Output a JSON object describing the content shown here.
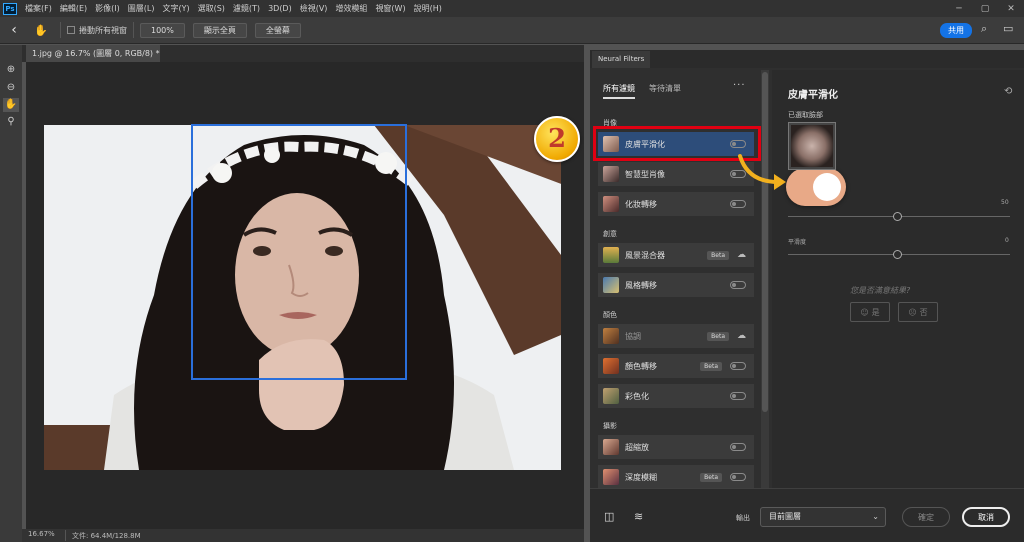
{
  "menubar": {
    "logo": "Ps",
    "items": [
      "檔案(F)",
      "編輯(E)",
      "影像(I)",
      "圖層(L)",
      "文字(Y)",
      "選取(S)",
      "濾鏡(T)",
      "3D(D)",
      "檢視(V)",
      "增效模組",
      "視窗(W)",
      "說明(H)"
    ]
  },
  "optionsbar": {
    "scroll_all_label": "捲動所有視窗",
    "zoom_100": "100%",
    "fit_screen": "顯示全頁",
    "fill_screen": "全螢幕",
    "share": "共用"
  },
  "document": {
    "tab_title": "1.jpg @ 16.7% (圖層 0, RGB/8) *",
    "zoom": "16.67%",
    "doc_size": "文件: 64.4M/128.8M"
  },
  "neural": {
    "panel_title": "Neural Filters",
    "tab_all": "所有濾鏡",
    "tab_wait": "等待清單",
    "more": "···",
    "sections": {
      "portrait": "肖像",
      "creative": "創意",
      "color": "顏色",
      "photo": "攝影"
    },
    "filters": {
      "skin": "皮膚平滑化",
      "smart": "智慧型肖像",
      "makeup": "化妝轉移",
      "landscape": "風景混合器",
      "style": "風格轉移",
      "harmony": "協調",
      "colortransfer": "顏色轉移",
      "colorize": "彩色化",
      "superzoom": "超縮放",
      "depthblur": "深度模糊"
    },
    "beta": "Beta",
    "step_number": "2"
  },
  "right_panel": {
    "title": "皮膚平滑化",
    "selected_face": "已選取臉部",
    "blur_value": "50",
    "smooth_label": "平滑度",
    "smooth_value": "0",
    "feedback_q": "您是否滿意結果?",
    "yes": "是",
    "no": "否"
  },
  "bottom": {
    "output_label": "輸出",
    "output_value": "目前圖層",
    "ok": "確定",
    "cancel": "取消"
  },
  "colors": {
    "accent_blue": "#1473e6",
    "highlight_red": "#e00012",
    "selected_row": "#2d4d7a",
    "face_box": "#2a6fdb"
  }
}
